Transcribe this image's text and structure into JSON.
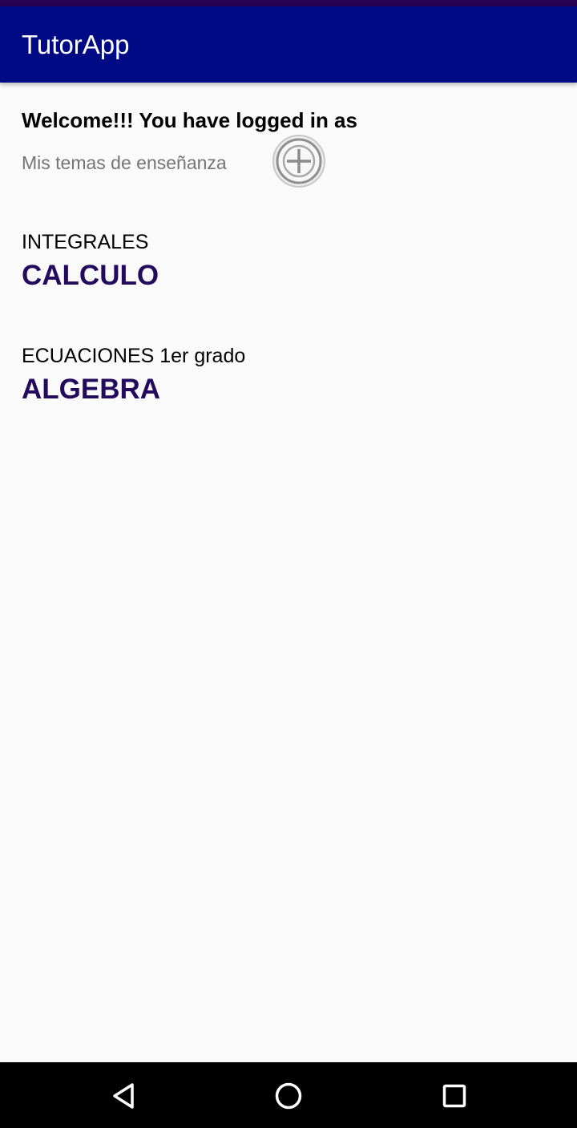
{
  "app": {
    "title": "TutorApp"
  },
  "header": {
    "welcome_text": "Welcome!!! You have logged in as",
    "subtitle": "Mis temas de enseñanza",
    "add_icon": "add-circle-icon"
  },
  "topics": [
    {
      "name": "INTEGRALES",
      "subject": "CALCULO"
    },
    {
      "name": "ECUACIONES 1er grado",
      "subject": "ALGEBRA"
    }
  ],
  "nav": {
    "back_icon": "back-triangle-icon",
    "home_icon": "home-circle-icon",
    "recents_icon": "recents-square-icon"
  },
  "colors": {
    "app_bar": "#000a85",
    "status_bar": "#2a0050",
    "subject_text": "#230a5c",
    "background": "#fafafa"
  }
}
